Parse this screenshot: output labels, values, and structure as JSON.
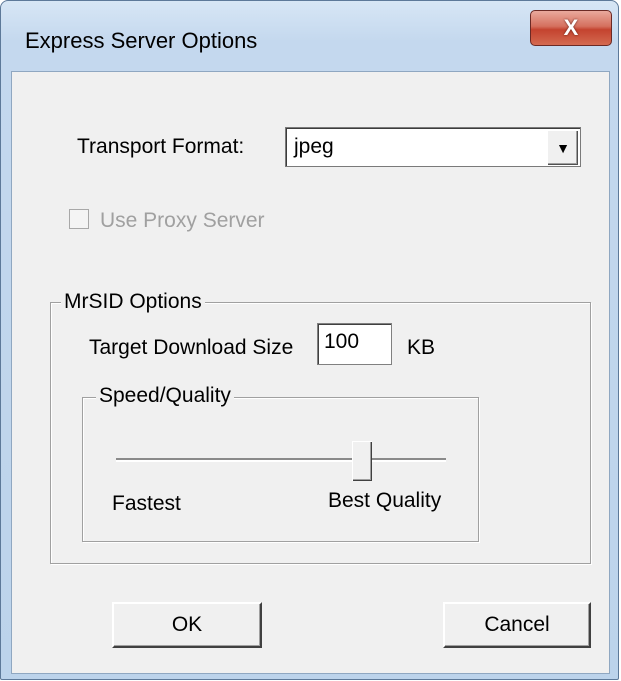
{
  "window": {
    "title": "Express Server Options",
    "close_label": "X"
  },
  "transport": {
    "label": "Transport Format:",
    "value": "jpeg",
    "arrow": "▼"
  },
  "proxy": {
    "label": "Use Proxy Server",
    "checked": false,
    "enabled": false
  },
  "mrsid": {
    "group_label": "MrSID Options",
    "target_label": "Target Download Size",
    "target_value": "100",
    "target_unit": "KB",
    "speed_quality": {
      "group_label": "Speed/Quality",
      "min_label": "Fastest",
      "max_label": "Best Quality",
      "level_fraction": 0.76
    }
  },
  "buttons": {
    "ok": "OK",
    "cancel": "Cancel"
  }
}
